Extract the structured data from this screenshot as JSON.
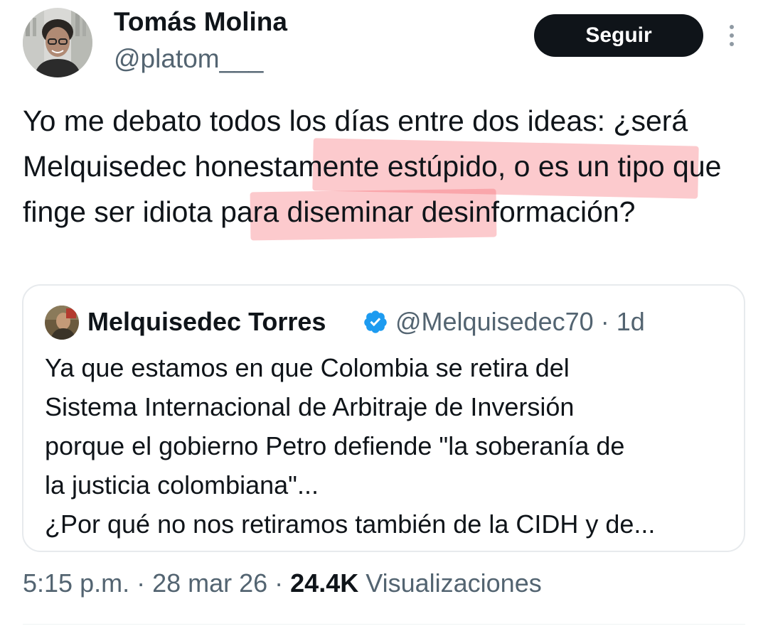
{
  "author": {
    "name": "Tomás Molina",
    "handle": "@platom___"
  },
  "follow_label": "Seguir",
  "tweet": {
    "pre1": "Yo me debato todos los días entre dos ideas: ¿será Melquisedec",
    "highlight1": "honestamente estúpido",
    "mid": ", o es un tipo que ",
    "highlight2": "finge ser idiota",
    "post": " para diseminar desinformación?"
  },
  "highlight_color": "#f55a64",
  "quoted": {
    "name": "Melquisedec Torres",
    "handle_time": "@Melquisedec70 · 1d",
    "lines": [
      "Ya que estamos en que Colombia se retira del",
      "Sistema Internacional de Arbitraje de Inversión",
      "porque el gobierno Petro defiende \"la soberanía de",
      "la justicia colombiana\"...",
      "¿Por qué no nos retiramos también de la CIDH y de..."
    ]
  },
  "meta": {
    "time_date": "5:15 p.m. · 28 mar 26 · ",
    "views_count": "24.4K",
    "views_label": " Visualizaciones"
  },
  "colors": {
    "text": "#0f1419",
    "secondary": "#536471",
    "button_bg": "#0f1419",
    "verified": "#1d9bf0",
    "border": "#e7eaed"
  },
  "icons": [
    "more-vertical-icon",
    "verified-badge-icon"
  ]
}
